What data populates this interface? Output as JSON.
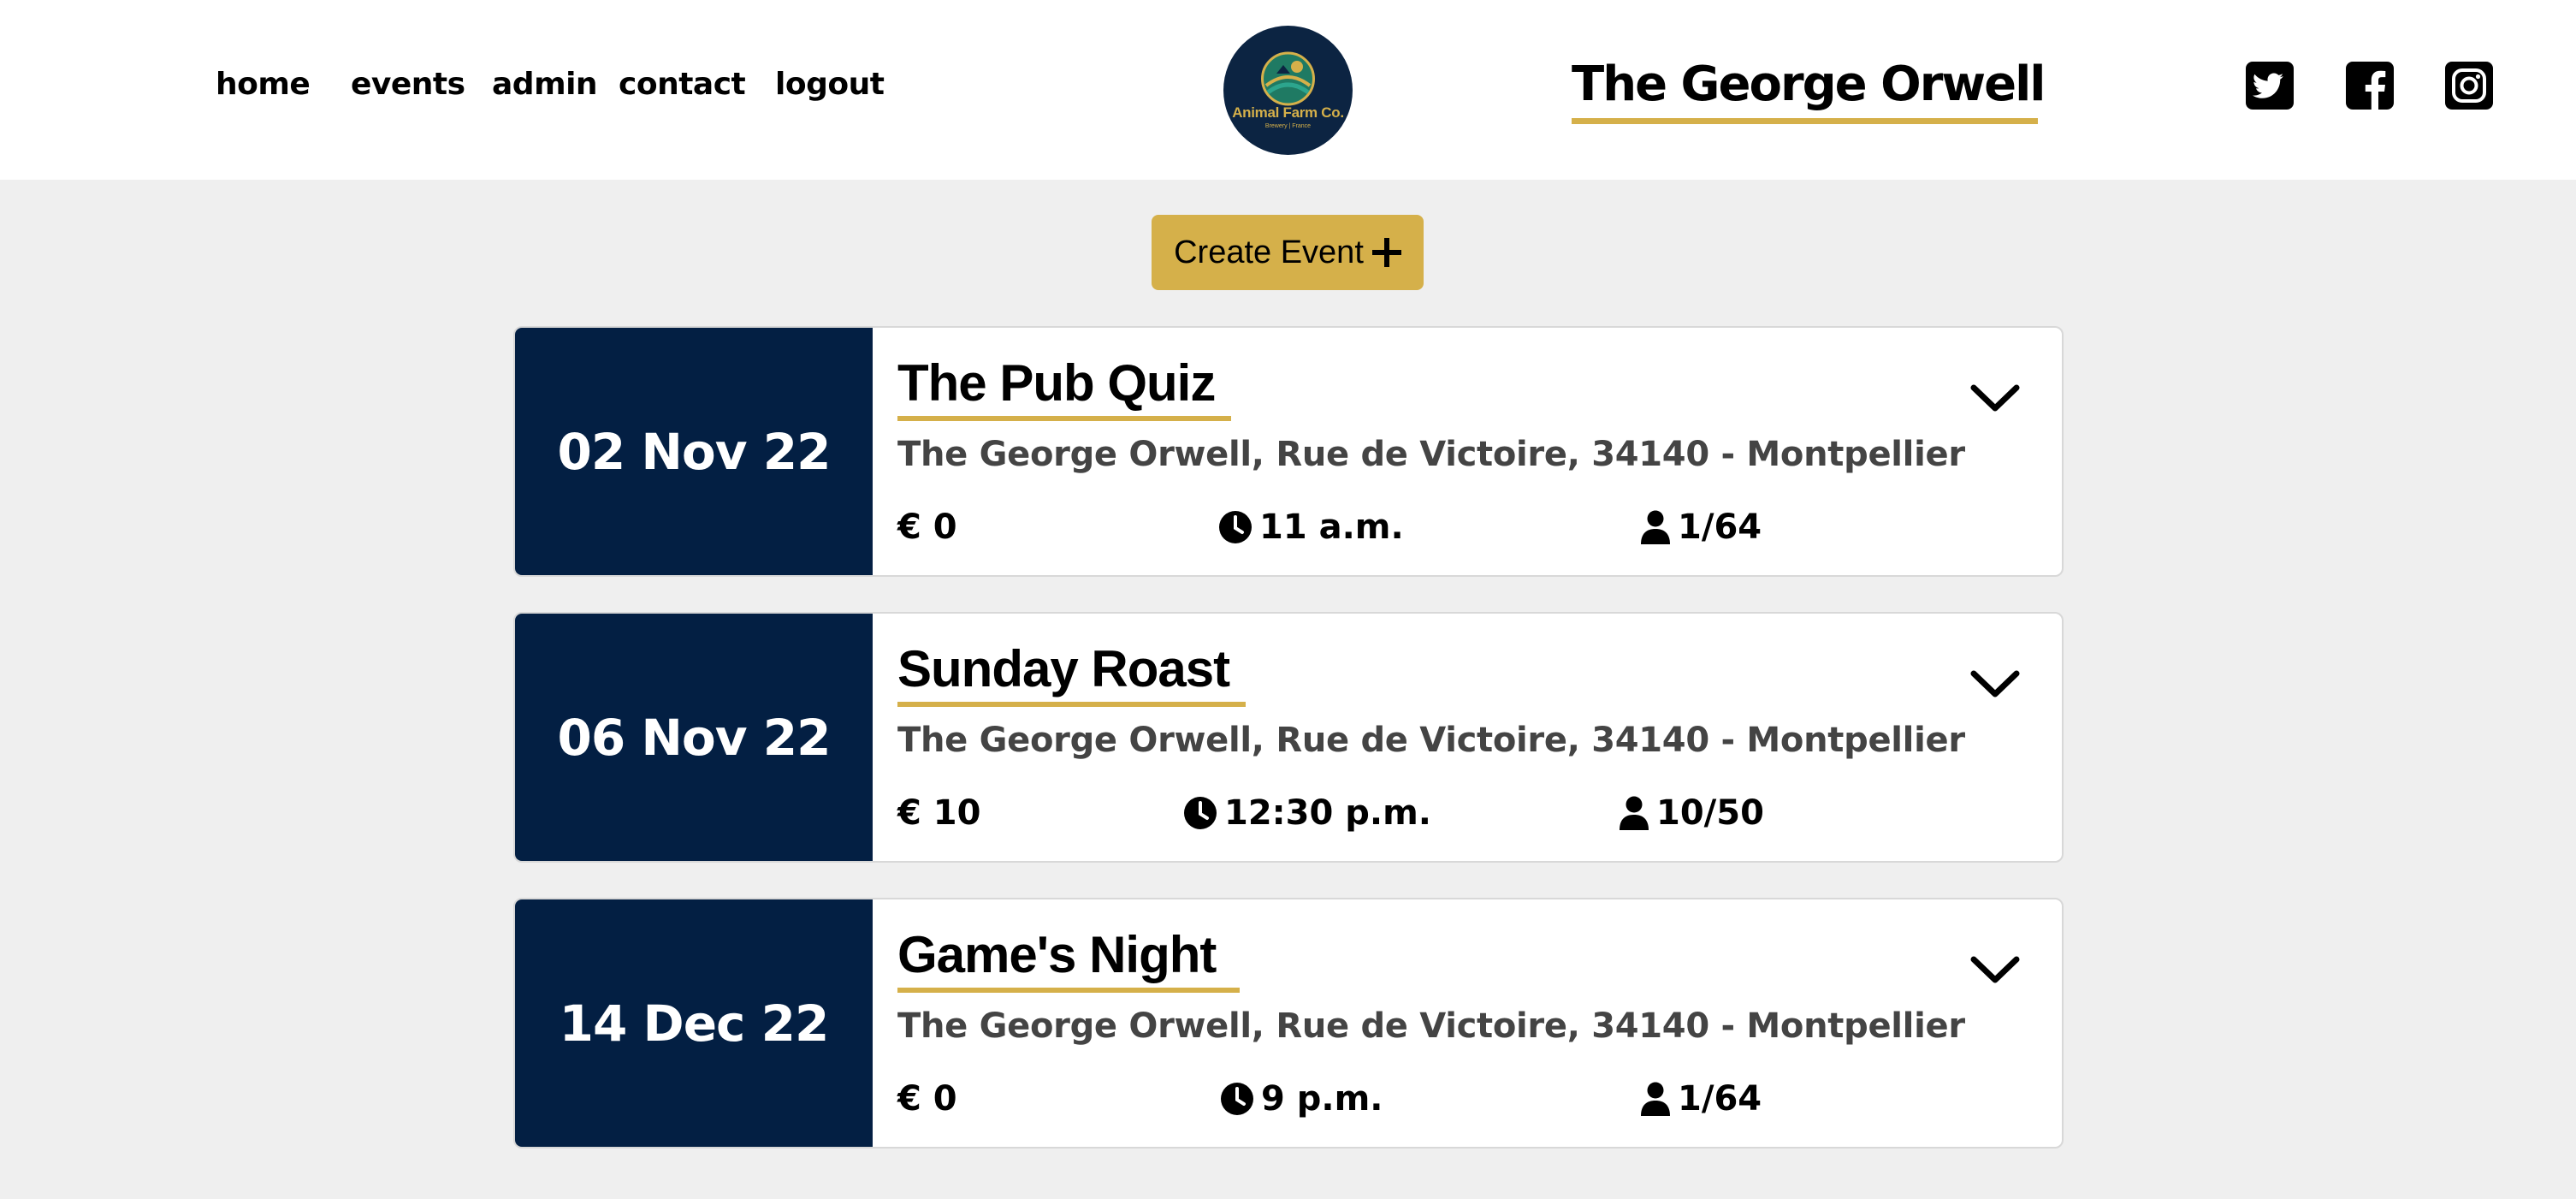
{
  "nav": {
    "items": [
      {
        "label": "home"
      },
      {
        "label": "events"
      },
      {
        "label": "admin"
      },
      {
        "label": "contact"
      },
      {
        "label": "logout"
      }
    ]
  },
  "logo": {
    "name": "Animal Farm Co.",
    "tagline": "Brewery | France",
    "bg_color": "#0c2442",
    "accent_color": "#d5b04a"
  },
  "site_title": "The George Orwell",
  "social": [
    {
      "icon": "twitter-icon"
    },
    {
      "icon": "facebook-icon"
    },
    {
      "icon": "instagram-icon"
    }
  ],
  "create_button": {
    "label": "Create Event",
    "icon": "plus-icon"
  },
  "colors": {
    "accent": "#d5b04a",
    "navy": "#031f43",
    "background": "#efefef"
  },
  "events": [
    {
      "date": "02 Nov 22",
      "title": "The Pub Quiz",
      "address": "The George Orwell, Rue de Victoire, 34140 - Montpellier",
      "price": "€ 0",
      "time": "11 a.m.",
      "attendees": "1/64"
    },
    {
      "date": "06 Nov 22",
      "title": "Sunday Roast",
      "address": "The George Orwell, Rue de Victoire, 34140 - Montpellier",
      "price": "€ 10",
      "time": "12:30 p.m.",
      "attendees": "10/50"
    },
    {
      "date": "14 Dec 22",
      "title": "Game's Night",
      "address": "The George Orwell, Rue de Victoire, 34140 - Montpellier",
      "price": "€ 0",
      "time": "9 p.m.",
      "attendees": "1/64"
    }
  ]
}
